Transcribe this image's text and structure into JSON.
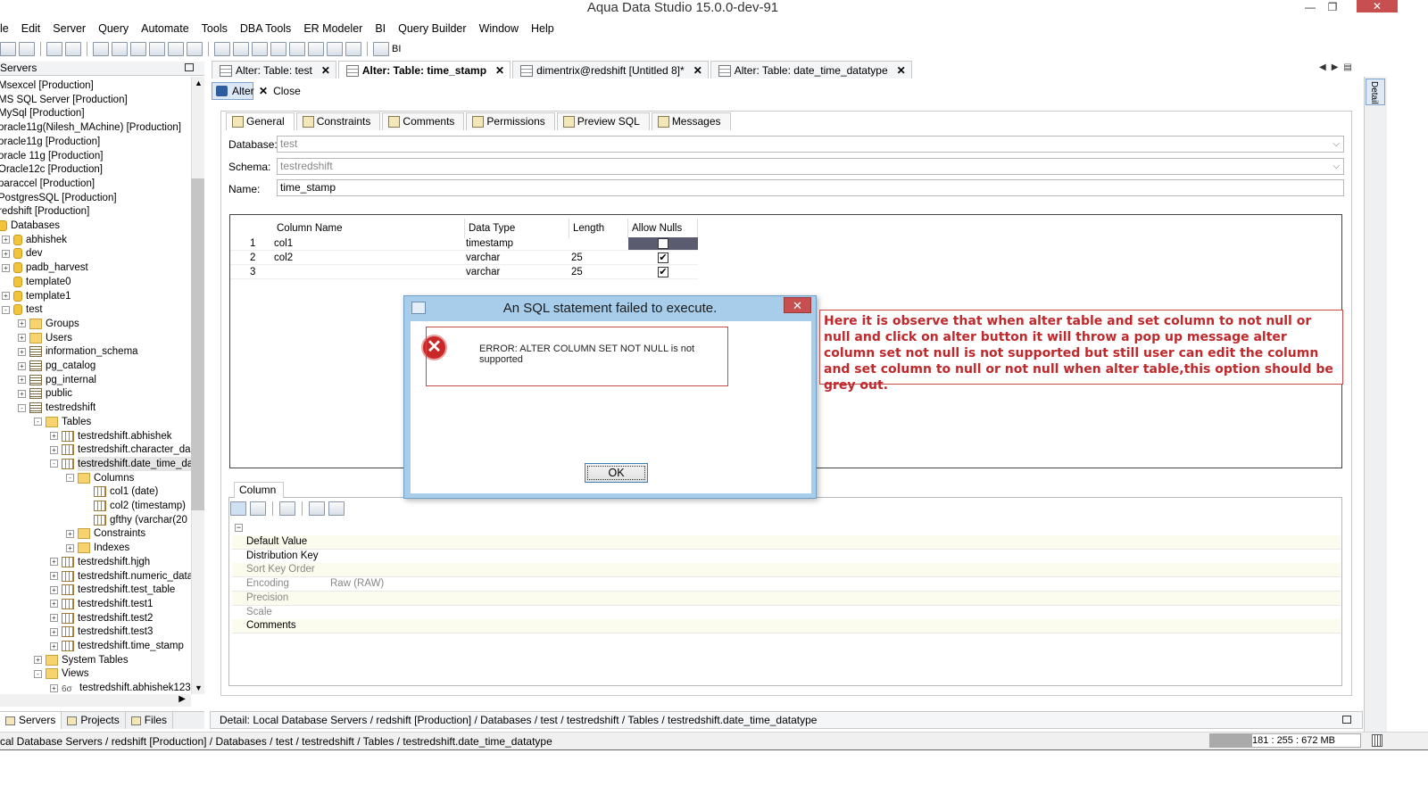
{
  "window": {
    "title": "Aqua Data Studio 15.0.0-dev-91",
    "minimize": "—",
    "restore": "❐",
    "close": "✕"
  },
  "menu": [
    "le",
    "Edit",
    "Server",
    "Query",
    "Automate",
    "Tools",
    "DBA Tools",
    "ER Modeler",
    "BI",
    "Query Builder",
    "Window",
    "Help"
  ],
  "toolbar": {
    "bi_label": "BI"
  },
  "servers_panel": {
    "title": "Servers"
  },
  "tree": [
    {
      "label": "Msexcel [Production]",
      "indent": 0,
      "icon": "none",
      "exp": ""
    },
    {
      "label": "MS SQL Server [Production]",
      "indent": 0,
      "icon": "none",
      "exp": ""
    },
    {
      "label": "MySql [Production]",
      "indent": 0,
      "icon": "none",
      "exp": ""
    },
    {
      "label": "oracle11g(Nilesh_MAchine) [Production]",
      "indent": 0,
      "icon": "none",
      "exp": ""
    },
    {
      "label": "oracle11g [Production]",
      "indent": 0,
      "icon": "none",
      "exp": ""
    },
    {
      "label": "oracle 11g [Production]",
      "indent": 0,
      "icon": "none",
      "exp": ""
    },
    {
      "label": "Oracle12c [Production]",
      "indent": 0,
      "icon": "none",
      "exp": ""
    },
    {
      "label": "paraccel [Production]",
      "indent": 0,
      "icon": "none",
      "exp": ""
    },
    {
      "label": "PostgresSQL [Production]",
      "indent": 0,
      "icon": "none",
      "exp": ""
    },
    {
      "label": "redshift [Production]",
      "indent": 0,
      "icon": "none",
      "exp": ""
    },
    {
      "label": "Databases",
      "indent": 0,
      "icon": "db",
      "exp": ""
    },
    {
      "label": "abhishek",
      "indent": 1,
      "icon": "db",
      "exp": "+"
    },
    {
      "label": "dev",
      "indent": 1,
      "icon": "db",
      "exp": "+"
    },
    {
      "label": "padb_harvest",
      "indent": 1,
      "icon": "db",
      "exp": "+"
    },
    {
      "label": "template0",
      "indent": 1,
      "icon": "db",
      "exp": ""
    },
    {
      "label": "template1",
      "indent": 1,
      "icon": "db",
      "exp": "+"
    },
    {
      "label": "test",
      "indent": 1,
      "icon": "db",
      "exp": "-"
    },
    {
      "label": "Groups",
      "indent": 2,
      "icon": "folder",
      "exp": "+"
    },
    {
      "label": "Users",
      "indent": 2,
      "icon": "folder",
      "exp": "+"
    },
    {
      "label": "information_schema",
      "indent": 2,
      "icon": "schema",
      "exp": "+"
    },
    {
      "label": "pg_catalog",
      "indent": 2,
      "icon": "schema",
      "exp": "+"
    },
    {
      "label": "pg_internal",
      "indent": 2,
      "icon": "schema",
      "exp": "+"
    },
    {
      "label": "public",
      "indent": 2,
      "icon": "schema",
      "exp": "+"
    },
    {
      "label": "testredshift",
      "indent": 2,
      "icon": "schema",
      "exp": "-"
    },
    {
      "label": "Tables",
      "indent": 3,
      "icon": "folder",
      "exp": "-"
    },
    {
      "label": "testredshift.abhishek",
      "indent": 4,
      "icon": "table",
      "exp": "+"
    },
    {
      "label": "testredshift.character_da",
      "indent": 4,
      "icon": "table",
      "exp": "+"
    },
    {
      "label": "testredshift.date_time_da",
      "indent": 4,
      "icon": "table",
      "exp": "-"
    },
    {
      "label": "Columns",
      "indent": 5,
      "icon": "folder",
      "exp": "-"
    },
    {
      "label": "col1 (date)",
      "indent": 6,
      "icon": "table",
      "exp": ""
    },
    {
      "label": "col2 (timestamp)",
      "indent": 6,
      "icon": "table",
      "exp": ""
    },
    {
      "label": "gfthy (varchar(20",
      "indent": 6,
      "icon": "table",
      "exp": ""
    },
    {
      "label": "Constraints",
      "indent": 5,
      "icon": "folder",
      "exp": "+"
    },
    {
      "label": "Indexes",
      "indent": 5,
      "icon": "folder",
      "exp": "+"
    },
    {
      "label": "testredshift.hjgh",
      "indent": 4,
      "icon": "table",
      "exp": "+"
    },
    {
      "label": "testredshift.numeric_data",
      "indent": 4,
      "icon": "table",
      "exp": "+"
    },
    {
      "label": "testredshift.test_table",
      "indent": 4,
      "icon": "table",
      "exp": "+"
    },
    {
      "label": "testredshift.test1",
      "indent": 4,
      "icon": "table",
      "exp": "+"
    },
    {
      "label": "testredshift.test2",
      "indent": 4,
      "icon": "table",
      "exp": "+"
    },
    {
      "label": "testredshift.test3",
      "indent": 4,
      "icon": "table",
      "exp": "+"
    },
    {
      "label": "testredshift.time_stamp",
      "indent": 4,
      "icon": "table",
      "exp": "+"
    },
    {
      "label": "System Tables",
      "indent": 3,
      "icon": "folder",
      "exp": "+"
    },
    {
      "label": "Views",
      "indent": 3,
      "icon": "folder",
      "exp": "-"
    },
    {
      "label": "testredshift.abhishek123",
      "indent": 4,
      "icon": "view",
      "exp": "+"
    }
  ],
  "left_tabs": [
    "Servers",
    "Projects",
    "Files"
  ],
  "doc_tabs": [
    {
      "label": "Alter: Table: test",
      "active": false
    },
    {
      "label": "Alter: Table: time_stamp",
      "active": true
    },
    {
      "label": "dimentrix@redshift [Untitled 8]*",
      "active": false
    },
    {
      "label": "Alter: Table: date_time_datatype",
      "active": false
    }
  ],
  "side_tab": "Detail",
  "actions": {
    "alter": "Alter",
    "close": "Close"
  },
  "sub_tabs": [
    "General",
    "Constraints",
    "Comments",
    "Permissions",
    "Preview SQL",
    "Messages"
  ],
  "form": {
    "database_label": "Database:",
    "database_value": "test",
    "schema_label": "Schema:",
    "schema_value": "testredshift",
    "name_label": "Name:",
    "name_value": "time_stamp"
  },
  "grid": {
    "headers": [
      "Column Name",
      "Data Type",
      "Length",
      "Allow Nulls"
    ],
    "rows": [
      {
        "num": "1",
        "name": "col1",
        "type": "timestamp",
        "length": "",
        "nulls": false,
        "selected": true
      },
      {
        "num": "2",
        "name": "col2",
        "type": "varchar",
        "length": "25",
        "nulls": true,
        "selected": false
      },
      {
        "num": "3",
        "name": "",
        "type": "varchar",
        "length": "25",
        "nulls": true,
        "selected": false
      }
    ]
  },
  "column_panel": {
    "tab": "Column",
    "collapse": "−",
    "properties": [
      {
        "name": "Default Value",
        "value": "",
        "grey": false
      },
      {
        "name": "Distribution Key",
        "value": "",
        "grey": false
      },
      {
        "name": "Sort Key Order",
        "value": "",
        "grey": true
      },
      {
        "name": "Encoding",
        "value": "Raw (RAW)",
        "grey": true
      },
      {
        "name": "Precision",
        "value": "",
        "grey": true
      },
      {
        "name": "Scale",
        "value": "",
        "grey": true
      },
      {
        "name": "Comments",
        "value": "",
        "grey": false
      }
    ]
  },
  "detail_bar": "Detail: Local Database Servers / redshift [Production] / Databases / test / testredshift / Tables / testredshift.date_time_datatype",
  "status_bar": "cal Database Servers / redshift [Production] / Databases / test / testredshift / Tables / testredshift.date_time_datatype",
  "memory": "181 : 255 : 672 MB",
  "dialog": {
    "title": "An SQL statement failed to execute.",
    "close": "✕",
    "error_glyph": "✕",
    "message": "ERROR: ALTER COLUMN SET NOT NULL is not supported",
    "ok": "OK"
  },
  "annotation": "Here it is observe that when alter table and set column to not null or null and click on alter button it will throw a pop up message alter column set not null  is not supported but still user can edit the column and set column to null or not null when alter table,this option should be grey out."
}
